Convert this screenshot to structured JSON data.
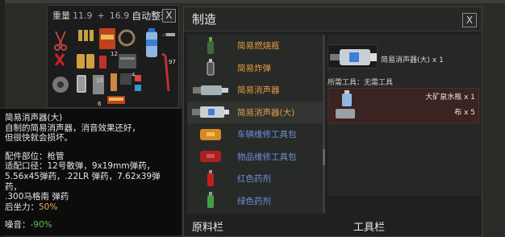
{
  "inventory": {
    "weight_label": "重量",
    "weight_current": "11.9",
    "weight_sep": "+",
    "weight_capacity": "16.9",
    "auto_sort": "自动整理",
    "close": "X",
    "counts": [
      "12",
      "10",
      "4",
      "6",
      "97"
    ]
  },
  "tooltip": {
    "title": "简易消声器(大)",
    "desc1": "自制的简易消声器，消音效果还好，",
    "desc2": "但很快就会损坏。",
    "slot": "配件部位：枪管",
    "caliber1": "适配口径：12号散弹，9x19mm弹药，",
    "caliber2": "5.56x45弹药，.22LR 弹药，7.62x39弹药，",
    "caliber3": ".300马格南 弹药",
    "recoil_label": "后坐力：",
    "recoil_value": "50%",
    "noise_label": "噪音：",
    "noise_value": "-90%"
  },
  "craft": {
    "title": "制造",
    "close": "X",
    "recipes": [
      {
        "label": "简易燃烧瓶",
        "color": "orange"
      },
      {
        "label": "简易炸弹",
        "color": "orange"
      },
      {
        "label": "简易消声器",
        "color": "orange"
      },
      {
        "label": "简易消声器(大)",
        "color": "orange"
      },
      {
        "label": "车辆维修工具包",
        "color": "blue"
      },
      {
        "label": "物品维修工具包",
        "color": "blue"
      },
      {
        "label": "红色药剂",
        "color": "blue"
      },
      {
        "label": "绿色药剂",
        "color": "blue"
      }
    ],
    "output_name": "简易消声器(大) x 1",
    "tools_required": "所需工具：无需工具",
    "ingredients": [
      {
        "label": "大矿泉水瓶 x 1"
      },
      {
        "label": "布 x 5"
      }
    ],
    "footer_materials": "原料栏",
    "footer_tools": "工具栏"
  },
  "colors": {
    "recipe_orange": "#e49c43",
    "recipe_blue": "#6b8fd8",
    "recoil": "#e2b24f",
    "noise": "#58c34f",
    "ingredient_bg": "#3a2320"
  }
}
